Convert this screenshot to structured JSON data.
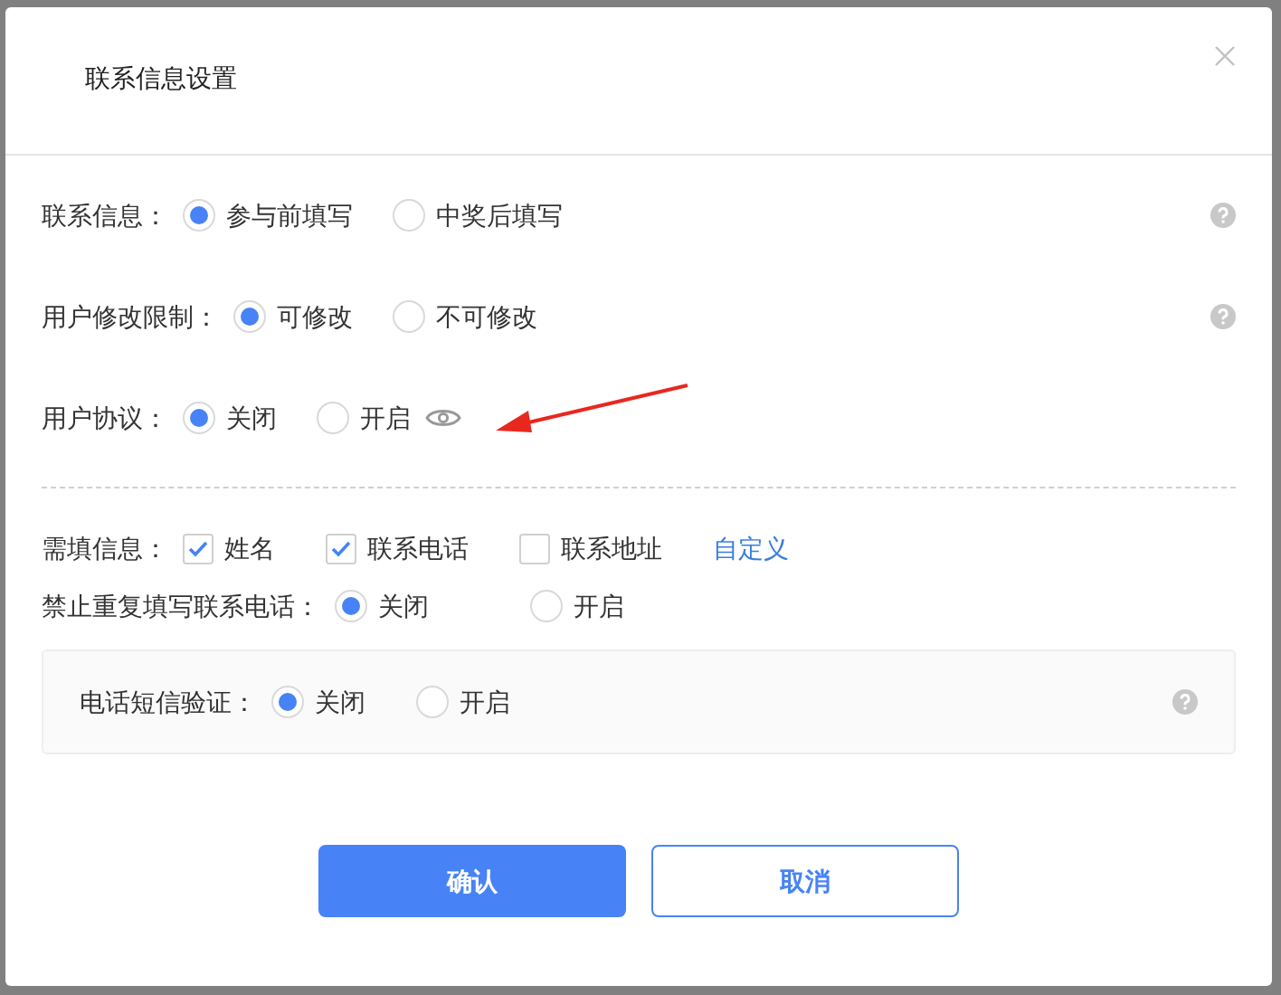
{
  "dialog": {
    "title": "联系信息设置"
  },
  "settings": [
    {
      "kind": "radio",
      "label": "联系信息：",
      "help": true,
      "preview": false,
      "options": [
        {
          "label": "参与前填写",
          "selected": true
        },
        {
          "label": "中奖后填写",
          "selected": false
        }
      ]
    },
    {
      "kind": "radio",
      "label": "用户修改限制：",
      "help": true,
      "preview": false,
      "options": [
        {
          "label": "可修改",
          "selected": true
        },
        {
          "label": "不可修改",
          "selected": false
        }
      ]
    },
    {
      "kind": "radio",
      "label": "用户协议：",
      "help": false,
      "preview": true,
      "options": [
        {
          "label": "关闭",
          "selected": true
        },
        {
          "label": "开启",
          "selected": false
        }
      ]
    }
  ],
  "required_info": {
    "label": "需填信息：",
    "options": [
      {
        "label": "姓名",
        "checked": true
      },
      {
        "label": "联系电话",
        "checked": true
      },
      {
        "label": "联系地址",
        "checked": false
      }
    ],
    "link": "自定义"
  },
  "duplicate_phone": {
    "label": "禁止重复填写联系电话：",
    "options": [
      {
        "label": "关闭",
        "selected": true
      },
      {
        "label": "开启",
        "selected": false
      }
    ]
  },
  "sms_verify": {
    "label": "电话短信验证：",
    "help": true,
    "options": [
      {
        "label": "关闭",
        "selected": true
      },
      {
        "label": "开启",
        "selected": false
      }
    ]
  },
  "buttons": [
    {
      "kind": "primary",
      "label": "确认"
    },
    {
      "kind": "secondary",
      "label": "取消"
    }
  ]
}
